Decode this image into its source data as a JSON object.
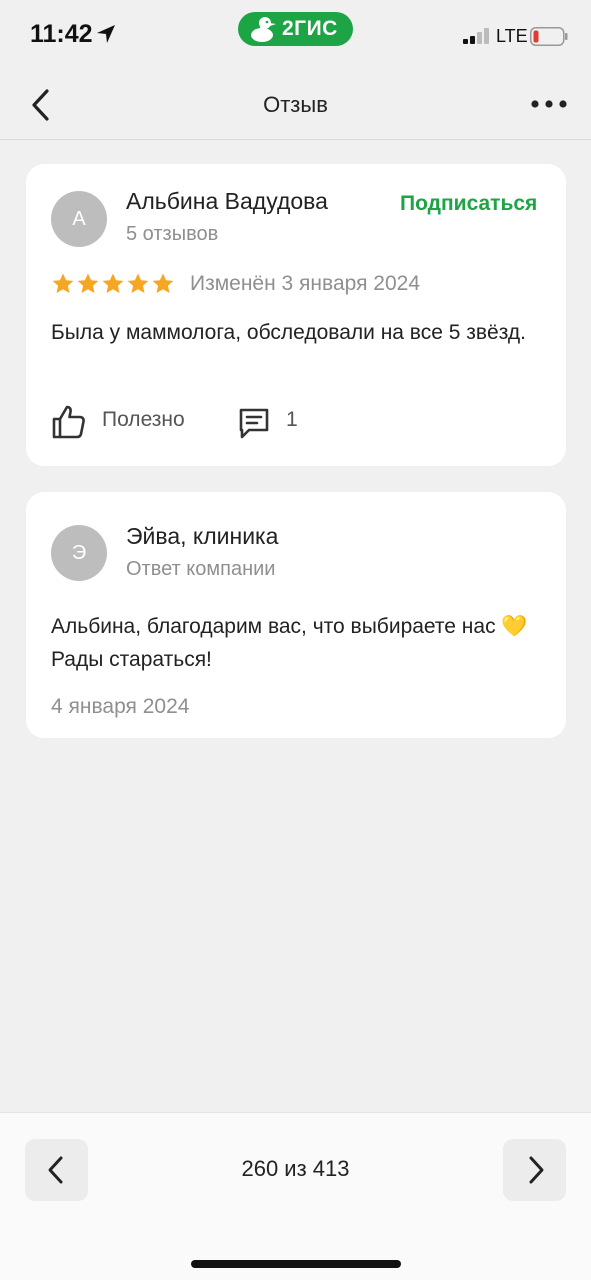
{
  "status_bar": {
    "time": "11:42",
    "brand": "2ГИС",
    "network": "LTE",
    "brand_color": "#1da445"
  },
  "nav": {
    "title": "Отзыв",
    "back_icon": "chevron-left-icon",
    "more_icon": "more-horizontal-icon"
  },
  "review": {
    "avatar_letter": "А",
    "author": "Альбина Вадудова",
    "reviews_count": "5 отзывов",
    "subscribe_label": "Подписаться",
    "rating": 5,
    "rating_max": 5,
    "edited": "Изменён 3 января 2024",
    "text": "Была у маммолога, обследовали на все 5 звёзд.",
    "helpful_label": "Полезно",
    "comments_count": "1",
    "star_color": "#f5a623"
  },
  "reply": {
    "avatar_letter": "Э",
    "author": "Эйва, клиника",
    "role": "Ответ компании",
    "text": "Альбина, благодарим вас, что выбираете нас 💛 Рады стараться!",
    "date": "4 января 2024"
  },
  "pager": {
    "label": "260 из 413",
    "prev_icon": "chevron-left-icon",
    "next_icon": "chevron-right-icon"
  }
}
